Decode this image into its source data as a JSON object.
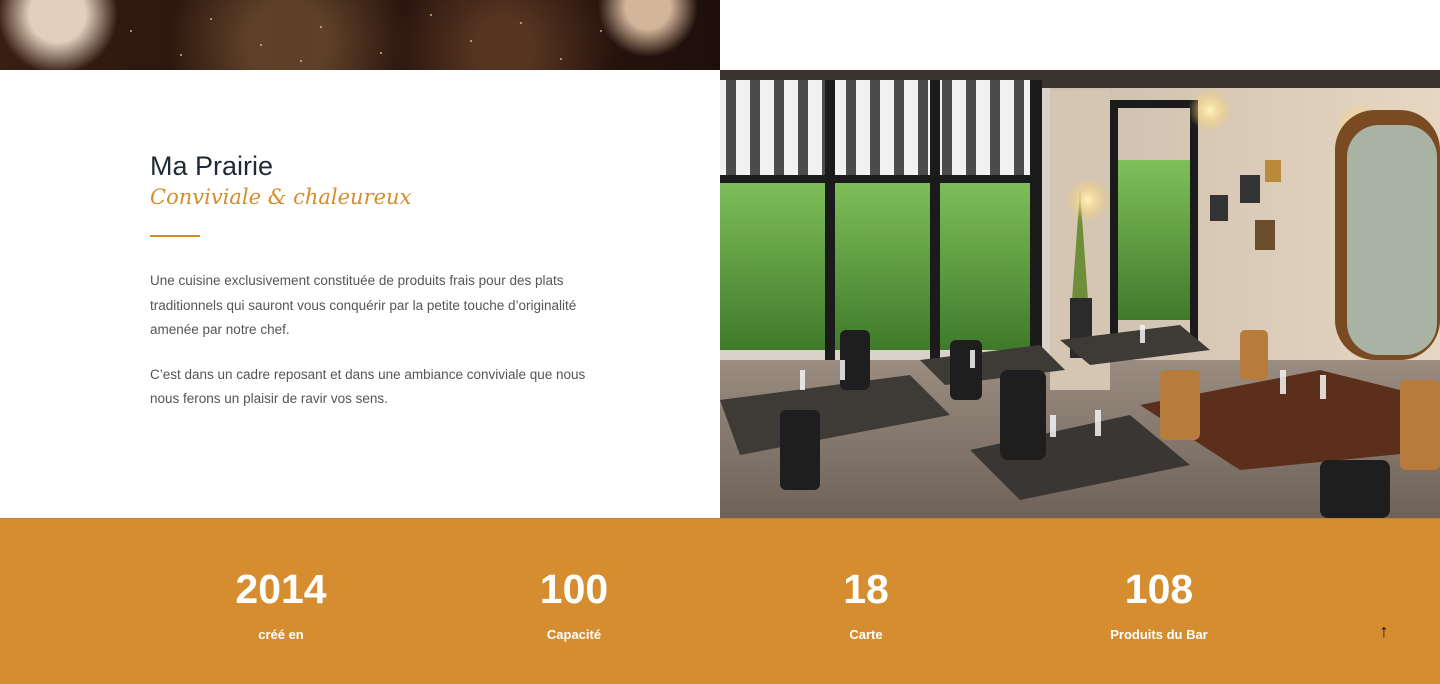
{
  "about": {
    "title": "Ma Prairie",
    "subtitle": "Conviviale & chaleureux",
    "paragraphs": [
      "Une cuisine exclusivement constituée de produits frais pour des plats traditionnels qui sauront vous conquérir par la petite touche d’originalité amenée par notre chef.",
      "C’est dans un cadre reposant et dans une ambiance conviviale que nous nous ferons un plaisir de ravir vos sens."
    ]
  },
  "stats": [
    {
      "number": "2014",
      "label": "créé en"
    },
    {
      "number": "100",
      "label": "Capacité"
    },
    {
      "number": "18",
      "label": "Carte"
    },
    {
      "number": "108",
      "label": "Produits du Bar"
    }
  ],
  "scroll_top": {
    "icon": "arrow-up-icon",
    "glyph": "↑"
  },
  "colors": {
    "accent": "#d58d2f",
    "title": "#1f2a36",
    "body_text": "#555555"
  }
}
